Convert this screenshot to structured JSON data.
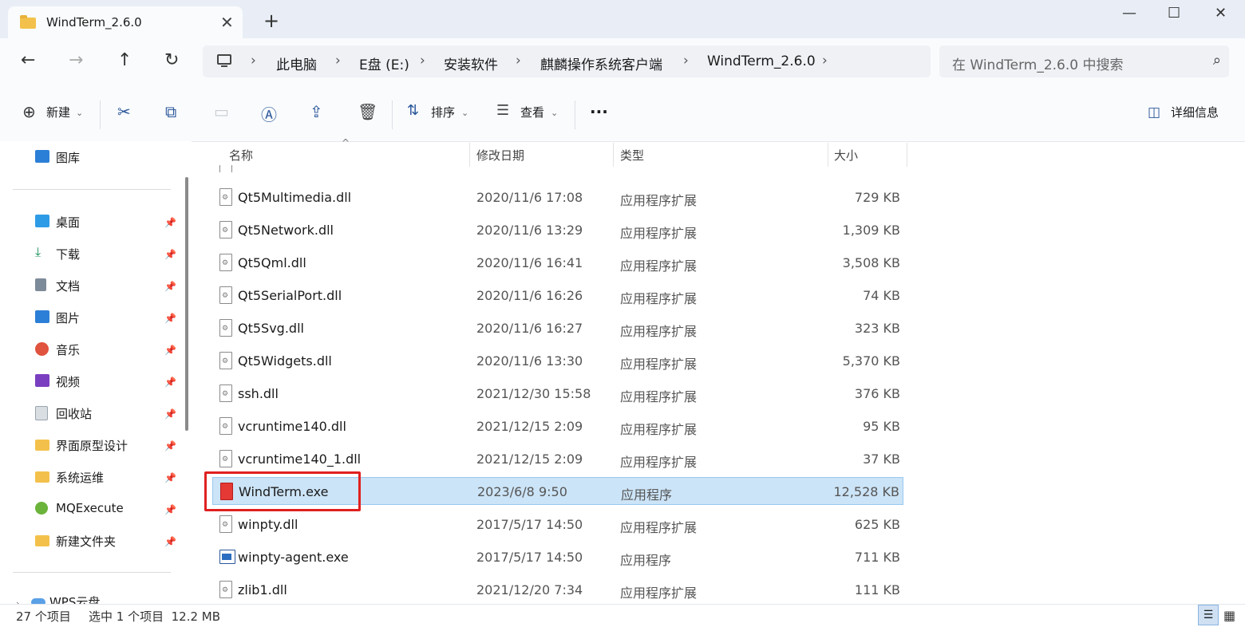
{
  "window": {
    "tab_title": "WindTerm_2.6.0",
    "tab_close": "✕",
    "new_tab": "+",
    "minimize": "—",
    "maximize": "☐",
    "close": "✕"
  },
  "nav": {
    "back": "←",
    "forward": "→",
    "up": "↑",
    "refresh": "↻",
    "breadcrumb": [
      "此电脑",
      "E盘 (E:)",
      "安装软件",
      "麒麟操作系统客户端",
      "WindTerm_2.6.0"
    ],
    "search_placeholder": "在 WindTerm_2.6.0 中搜索"
  },
  "toolbar": {
    "new_label": "新建",
    "sort_label": "排序",
    "view_label": "查看",
    "more": "···",
    "details_label": "详细信息"
  },
  "sidebar": {
    "top_item": "图库",
    "pinned": [
      {
        "label": "桌面",
        "icon": "desktop-icon",
        "color": "#2e9be6"
      },
      {
        "label": "下载",
        "icon": "download-icon",
        "color": "#1a8f5a"
      },
      {
        "label": "文档",
        "icon": "document-icon",
        "color": "#7d8a99"
      },
      {
        "label": "图片",
        "icon": "pictures-icon",
        "color": "#2c7fd6"
      },
      {
        "label": "音乐",
        "icon": "music-icon",
        "color": "#e0533f"
      },
      {
        "label": "视频",
        "icon": "video-icon",
        "color": "#7a3fc0"
      },
      {
        "label": "回收站",
        "icon": "recycle-bin-icon",
        "color": "#9aa4ad"
      },
      {
        "label": "界面原型设计",
        "icon": "folder-icon",
        "color": "#f3c14b"
      },
      {
        "label": "系统运维",
        "icon": "folder-icon",
        "color": "#f3c14b"
      },
      {
        "label": "MQExecute",
        "icon": "app-icon",
        "color": "#6bb33a"
      },
      {
        "label": "新建文件夹",
        "icon": "folder-icon",
        "color": "#f3c14b"
      }
    ],
    "bottom_item": "WPS云盘"
  },
  "columns": {
    "name": "名称",
    "date": "修改日期",
    "type": "类型",
    "size": "大小"
  },
  "files": [
    {
      "name": "Qt5Multimedia.dll",
      "date": "2020/11/6 17:08",
      "type": "应用程序扩展",
      "size": "729 KB",
      "icon": "dll"
    },
    {
      "name": "Qt5Network.dll",
      "date": "2020/11/6 13:29",
      "type": "应用程序扩展",
      "size": "1,309 KB",
      "icon": "dll"
    },
    {
      "name": "Qt5Qml.dll",
      "date": "2020/11/6 16:41",
      "type": "应用程序扩展",
      "size": "3,508 KB",
      "icon": "dll"
    },
    {
      "name": "Qt5SerialPort.dll",
      "date": "2020/11/6 16:26",
      "type": "应用程序扩展",
      "size": "74 KB",
      "icon": "dll"
    },
    {
      "name": "Qt5Svg.dll",
      "date": "2020/11/6 16:27",
      "type": "应用程序扩展",
      "size": "323 KB",
      "icon": "dll"
    },
    {
      "name": "Qt5Widgets.dll",
      "date": "2020/11/6 13:30",
      "type": "应用程序扩展",
      "size": "5,370 KB",
      "icon": "dll"
    },
    {
      "name": "ssh.dll",
      "date": "2021/12/30 15:58",
      "type": "应用程序扩展",
      "size": "376 KB",
      "icon": "dll"
    },
    {
      "name": "vcruntime140.dll",
      "date": "2021/12/15 2:09",
      "type": "应用程序扩展",
      "size": "95 KB",
      "icon": "dll"
    },
    {
      "name": "vcruntime140_1.dll",
      "date": "2021/12/15 2:09",
      "type": "应用程序扩展",
      "size": "37 KB",
      "icon": "dll"
    },
    {
      "name": "WindTerm.exe",
      "date": "2023/6/8 9:50",
      "type": "应用程序",
      "size": "12,528 KB",
      "icon": "exe-red",
      "selected": true
    },
    {
      "name": "winpty.dll",
      "date": "2017/5/17 14:50",
      "type": "应用程序扩展",
      "size": "625 KB",
      "icon": "dll"
    },
    {
      "name": "winpty-agent.exe",
      "date": "2017/5/17 14:50",
      "type": "应用程序",
      "size": "711 KB",
      "icon": "exe-blue"
    },
    {
      "name": "zlib1.dll",
      "date": "2021/12/20 7:34",
      "type": "应用程序扩展",
      "size": "111 KB",
      "icon": "dll"
    }
  ],
  "status": {
    "item_count": "27 个项目",
    "selection": "选中 1 个项目  12.2 MB"
  }
}
